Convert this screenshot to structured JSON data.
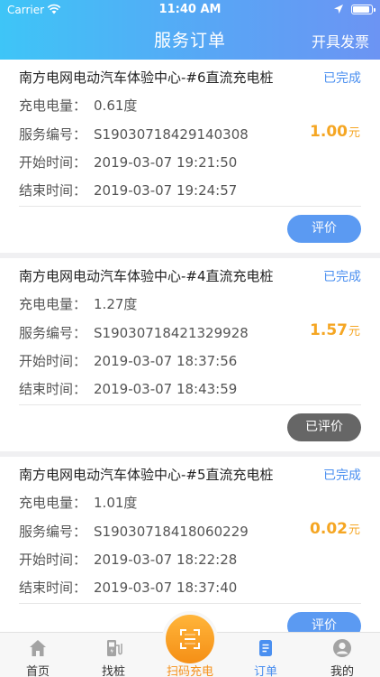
{
  "status_bar": {
    "carrier": "Carrier",
    "time": "11:40 AM"
  },
  "header": {
    "title": "服务订单",
    "invoice_label": "开具发票"
  },
  "labels": {
    "energy": "充电电量：",
    "service_no": "服务编号：",
    "start_time": "开始时间：",
    "end_time": "结束时间：",
    "currency_unit": "元"
  },
  "orders": [
    {
      "station": "南方电网电动汽车体验中心-#6直流充电桩",
      "status": "已完成",
      "energy": "0.61度",
      "service_no": "S19030718429140308",
      "amount": "1.00",
      "start": "2019-03-07 19:21:50",
      "end": "2019-03-07 19:24:57",
      "action": "评价"
    },
    {
      "station": "南方电网电动汽车体验中心-#4直流充电桩",
      "status": "已完成",
      "energy": "1.27度",
      "service_no": "S19030718421329928",
      "amount": "1.57",
      "start": "2019-03-07 18:37:56",
      "end": "2019-03-07 18:43:59",
      "action": "已评价"
    },
    {
      "station": "南方电网电动汽车体验中心-#5直流充电桩",
      "status": "已完成",
      "energy": "1.01度",
      "service_no": "S19030718418060229",
      "amount": "0.02",
      "start": "2019-03-07 18:22:28",
      "end": "2019-03-07 18:37:40",
      "action": "评价"
    }
  ],
  "tabbar": {
    "home": "首页",
    "find_pile": "找桩",
    "scan": "扫码充电",
    "orders": "订单",
    "mine": "我的",
    "active": "orders"
  },
  "colors": {
    "accent": "#4a8ff0",
    "amount": "#f5a623",
    "scan": "#f58f16"
  }
}
